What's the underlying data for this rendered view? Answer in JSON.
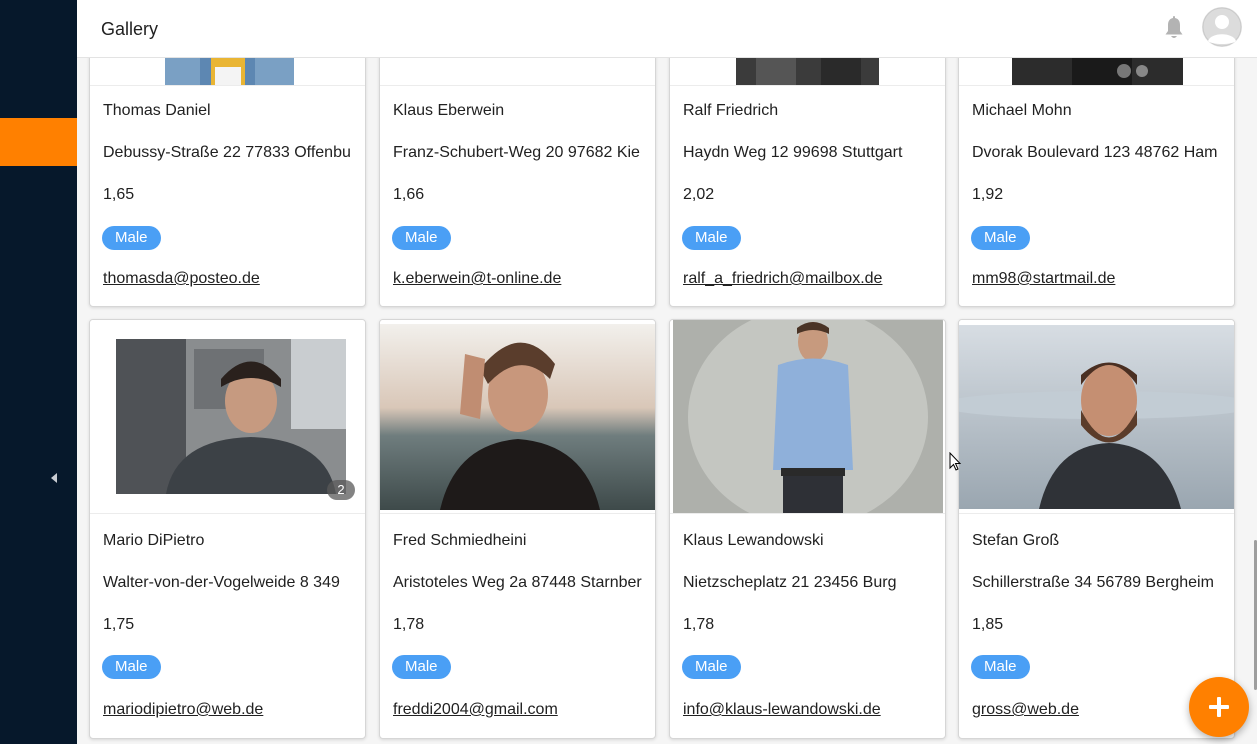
{
  "header": {
    "title": "Gallery"
  },
  "icons": {
    "sidebar_toggle": "chevron-left-icon",
    "bell": "bell-icon",
    "avatar": "user-avatar-icon",
    "fab": "plus-icon"
  },
  "colors": {
    "sidebar": "#06182b",
    "accent": "#ff8000",
    "badge": "#4a9ff5"
  },
  "cards_row1": [
    {
      "name": "Thomas Daniel",
      "address": "Debussy-Straße 22 77833 Offenbu",
      "height": "1,65",
      "gender": "Male",
      "email": "thomasda@posteo.de"
    },
    {
      "name": "Klaus Eberwein",
      "address": "Franz-Schubert-Weg 20 97682 Kie",
      "height": "1,66",
      "gender": "Male",
      "email": "k.eberwein@t-online.de"
    },
    {
      "name": "Ralf Friedrich",
      "address": "Haydn Weg 12 99698 Stuttgart",
      "height": "2,02",
      "gender": "Male",
      "email": "ralf_a_friedrich@mailbox.de"
    },
    {
      "name": "Michael Mohn",
      "address": "Dvorak Boulevard 123 48762 Ham",
      "height": "1,92",
      "gender": "Male",
      "email": "mm98@startmail.de"
    }
  ],
  "cards_row2": [
    {
      "name": "Mario DiPietro",
      "address": "Walter-von-der-Vogelweide 8 349",
      "height": "1,75",
      "gender": "Male",
      "email": "mariodipietro@web.de",
      "image_count": "2"
    },
    {
      "name": "Fred Schmiedheini",
      "address": "Aristoteles Weg 2a 87448 Starnber",
      "height": "1,78",
      "gender": "Male",
      "email": "freddi2004@gmail.com"
    },
    {
      "name": "Klaus Lewandowski",
      "address": "Nietzscheplatz 21 23456 Burg",
      "height": "1,78",
      "gender": "Male",
      "email": "info@klaus-lewandowski.de"
    },
    {
      "name": "Stefan Groß",
      "address": "Schillerstraße 34 56789 Bergheim",
      "height": "1,85",
      "gender": "Male",
      "email": "gross@web.de"
    }
  ]
}
